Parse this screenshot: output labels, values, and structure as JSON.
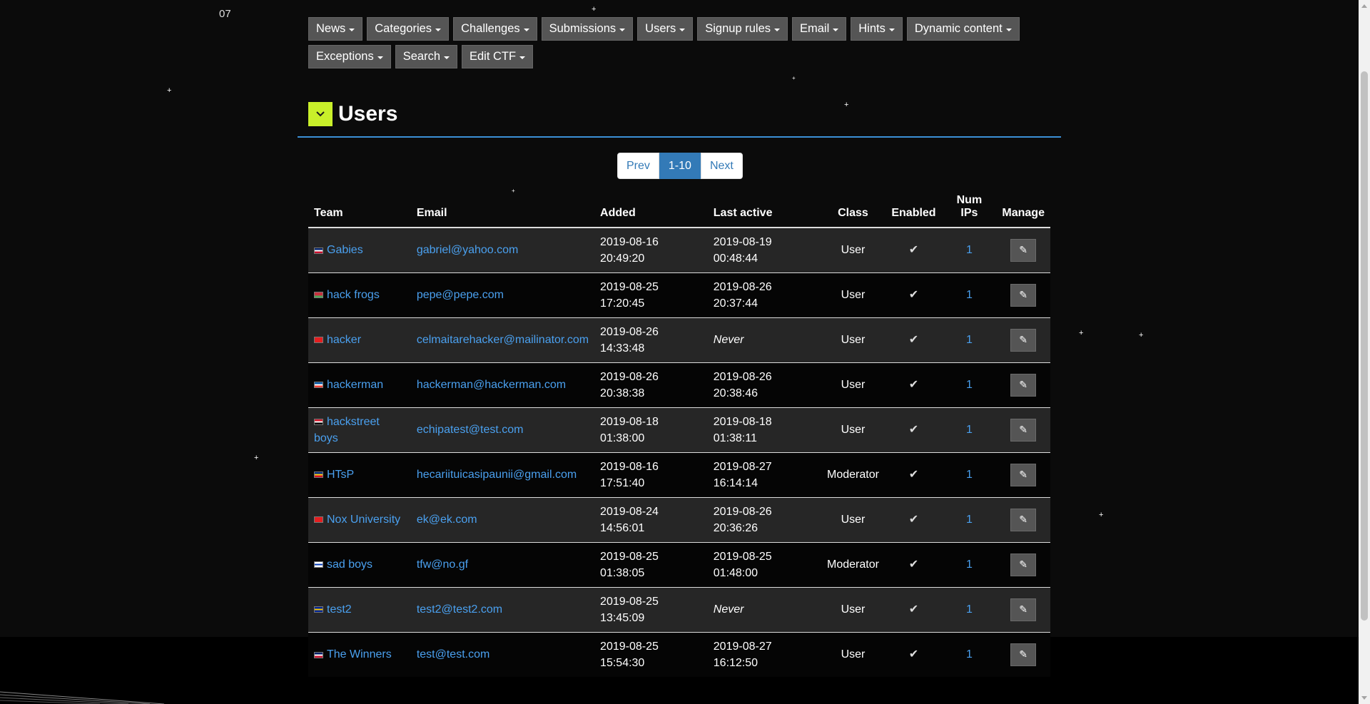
{
  "corner_text": "07",
  "menu": {
    "row1": [
      {
        "label": "News",
        "icon": "caret-down-icon"
      },
      {
        "label": "Categories",
        "icon": "caret-down-icon"
      },
      {
        "label": "Challenges",
        "icon": "caret-down-icon"
      },
      {
        "label": "Submissions",
        "icon": "caret-down-icon"
      },
      {
        "label": "Users",
        "icon": "caret-down-icon"
      },
      {
        "label": "Signup rules",
        "icon": "caret-down-icon"
      },
      {
        "label": "Email",
        "icon": "caret-down-icon"
      },
      {
        "label": "Hints",
        "icon": "caret-down-icon"
      },
      {
        "label": "Dynamic content",
        "icon": "caret-down-icon"
      }
    ],
    "row2": [
      {
        "label": "Exceptions",
        "icon": "caret-down-icon"
      },
      {
        "label": "Search",
        "icon": "caret-down-icon"
      },
      {
        "label": "Edit CTF",
        "icon": "caret-down-icon"
      }
    ]
  },
  "page": {
    "title": "Users",
    "toggle_icon": "chevron-down-icon",
    "toggle_color": "#c9f02a",
    "underline_color": "#3b8fd6"
  },
  "pagination": {
    "prev": "Prev",
    "current": "1-10",
    "next": "Next"
  },
  "table": {
    "headers": {
      "team": "Team",
      "email": "Email",
      "added": "Added",
      "last_active": "Last active",
      "class": "Class",
      "enabled": "Enabled",
      "num_ips": "Num IPs",
      "manage": "Manage"
    },
    "rows": [
      {
        "flag": [
          "#012169",
          "#fff",
          "#c8102e"
        ],
        "team": "Gabies",
        "email": "gabriel@yahoo.com",
        "added_date": "2019-08-16",
        "added_time": "20:49:20",
        "last_date": "2019-08-19",
        "last_time": "00:48:44",
        "class": "User",
        "enabled_icon": "check-icon",
        "num_ips": "1",
        "manage_icon": "pencil-icon"
      },
      {
        "flag": [
          "#c8313e",
          "#c8313e",
          "#4aa657"
        ],
        "team": "hack frogs",
        "email": "pepe@pepe.com",
        "added_date": "2019-08-25",
        "added_time": "17:20:45",
        "last_date": "2019-08-26",
        "last_time": "20:37:44",
        "class": "User",
        "enabled_icon": "check-icon",
        "num_ips": "1",
        "manage_icon": "pencil-icon"
      },
      {
        "flag": [
          "#e41e20",
          "#e41e20",
          "#e41e20"
        ],
        "team": "hacker",
        "email": "celmaitarehacker@mailinator.com",
        "added_date": "2019-08-26",
        "added_time": "14:33:48",
        "last_date": "",
        "last_time": "",
        "last_never": "Never",
        "class": "User",
        "enabled_icon": "check-icon",
        "num_ips": "1",
        "manage_icon": "pencil-icon"
      },
      {
        "flag": [
          "#0055a4",
          "#fff",
          "#ef4135"
        ],
        "team": "hackerman",
        "email": "hackerman@hackerman.com",
        "added_date": "2019-08-26",
        "added_time": "20:38:38",
        "last_date": "2019-08-26",
        "last_time": "20:38:46",
        "class": "User",
        "enabled_icon": "check-icon",
        "num_ips": "1",
        "manage_icon": "pencil-icon"
      },
      {
        "flag": [
          "#ce1126",
          "#fff",
          "#000"
        ],
        "team": "hackstreet boys",
        "email": "echipatest@test.com",
        "added_date": "2019-08-18",
        "added_time": "01:38:00",
        "last_date": "2019-08-18",
        "last_time": "01:38:11",
        "class": "User",
        "enabled_icon": "check-icon",
        "num_ips": "1",
        "manage_icon": "pencil-icon"
      },
      {
        "flag": [
          "#002b7f",
          "#fcd116",
          "#ce1126"
        ],
        "team": "HTsP",
        "email": "hecariituicasipaunii@gmail.com",
        "added_date": "2019-08-16",
        "added_time": "17:51:40",
        "last_date": "2019-08-27",
        "last_time": "16:14:14",
        "class": "Moderator",
        "enabled_icon": "check-icon",
        "num_ips": "1",
        "manage_icon": "pencil-icon"
      },
      {
        "flag": [
          "#e41e20",
          "#e41e20",
          "#e41e20"
        ],
        "team": "Nox University",
        "email": "ek@ek.com",
        "added_date": "2019-08-24",
        "added_time": "14:56:01",
        "last_date": "2019-08-26",
        "last_time": "20:36:26",
        "class": "User",
        "enabled_icon": "check-icon",
        "num_ips": "1",
        "manage_icon": "pencil-icon"
      },
      {
        "flag": [
          "#fff",
          "#0038b8",
          "#fff"
        ],
        "team": "sad boys",
        "email": "tfw@no.gf",
        "added_date": "2019-08-25",
        "added_time": "01:38:05",
        "last_date": "2019-08-25",
        "last_time": "01:48:00",
        "class": "Moderator",
        "enabled_icon": "check-icon",
        "num_ips": "1",
        "manage_icon": "pencil-icon"
      },
      {
        "flag": [
          "#002395",
          "#fecb00",
          "#002395"
        ],
        "team": "test2",
        "email": "test2@test2.com",
        "added_date": "2019-08-25",
        "added_time": "13:45:09",
        "last_date": "",
        "last_time": "",
        "last_never": "Never",
        "class": "User",
        "enabled_icon": "check-icon",
        "num_ips": "1",
        "manage_icon": "pencil-icon"
      },
      {
        "flag": [
          "#012169",
          "#fff",
          "#c8102e"
        ],
        "team": "The Winners",
        "email": "test@test.com",
        "added_date": "2019-08-25",
        "added_time": "15:54:30",
        "last_date": "2019-08-27",
        "last_time": "16:12:50",
        "class": "User",
        "enabled_icon": "check-icon",
        "num_ips": "1",
        "manage_icon": "pencil-icon"
      }
    ]
  },
  "colors": {
    "background": "#0b0b0b",
    "link": "#4aa0ef",
    "menu_button": "#555555",
    "pagination_active": "#337ab7"
  }
}
